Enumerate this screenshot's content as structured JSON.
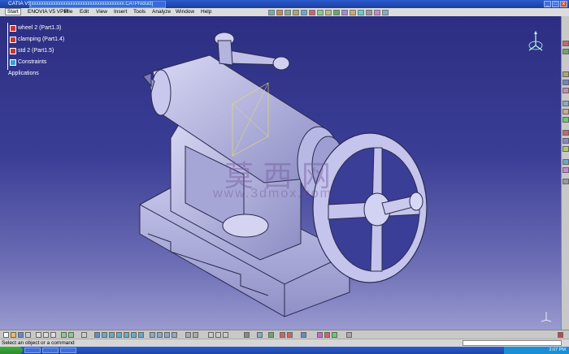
{
  "titlebar": {
    "title": "CATIA V5",
    "document": "[xxxxxxxxxxxxxxxxxxxxxxxxxxxxxxxxxxxxxx.CATProduct]",
    "min": "_",
    "max": "□",
    "close": "x"
  },
  "menu": [
    "Start",
    "ENOVIA V5 VPM",
    "File",
    "Edit",
    "View",
    "Insert",
    "Tools",
    "Analyze",
    "Window",
    "Help"
  ],
  "tree": [
    {
      "label": "wheel 2 (Part1.3)",
      "icon": "part-icon"
    },
    {
      "label": "clamping (Part1.4)",
      "icon": "part-icon"
    },
    {
      "label": "std 2 (Part1.5)",
      "icon": "part-icon"
    },
    {
      "label": "Constraints",
      "icon": "constraints-icon"
    },
    {
      "label": "Applications",
      "icon": ""
    }
  ],
  "watermark": {
    "cn": "莫 西 网",
    "url": "www.3dmox.com"
  },
  "status": {
    "message": "Select an object or a command"
  },
  "taskbar": {
    "clock": "2:07 PM"
  },
  "colors": {
    "viewport_top": "#2c2e82",
    "viewport_bottom": "#9a9ad0",
    "model": "#b8b8e8"
  }
}
